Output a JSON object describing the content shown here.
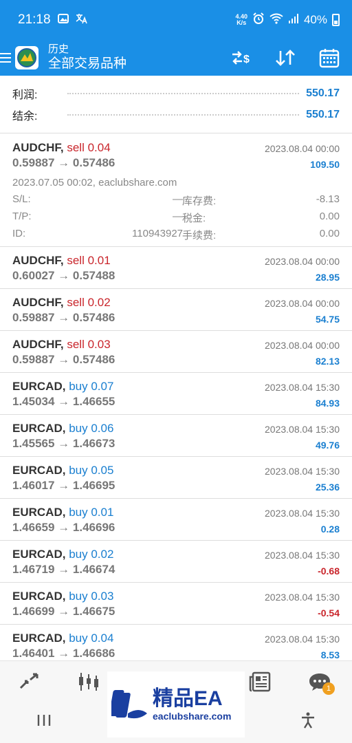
{
  "status_bar": {
    "time": "21:18",
    "net_speed_top": "4.40",
    "net_speed_bottom": "K/s",
    "battery": "40%"
  },
  "app_bar": {
    "title": "历史",
    "subtitle": "全部交易品种"
  },
  "summary": {
    "profit_label": "利润:",
    "profit_value": "550.17",
    "balance_label": "结余:",
    "balance_value": "550.17"
  },
  "trades": [
    {
      "symbol": "AUDCHF,",
      "side": "sell 0.04",
      "side_type": "sell",
      "open": "0.59887",
      "close": "0.57486",
      "date": "2023.08.04 00:00",
      "profit": "109.50",
      "details": {
        "open_time": "2023.07.05 00:02, eaclubshare.com",
        "sl_label": "S/L:",
        "sl_value": "—",
        "swap_label": "库存费:",
        "swap_value": "-8.13",
        "tp_label": "T/P:",
        "tp_value": "—",
        "tax_label": "税金:",
        "tax_value": "0.00",
        "id_label": "ID:",
        "id_value": "110943927",
        "fee_label": "手续费:",
        "fee_value": "0.00"
      }
    },
    {
      "symbol": "AUDCHF,",
      "side": "sell 0.01",
      "side_type": "sell",
      "open": "0.60027",
      "close": "0.57488",
      "date": "2023.08.04 00:00",
      "profit": "28.95"
    },
    {
      "symbol": "AUDCHF,",
      "side": "sell 0.02",
      "side_type": "sell",
      "open": "0.59887",
      "close": "0.57486",
      "date": "2023.08.04 00:00",
      "profit": "54.75"
    },
    {
      "symbol": "AUDCHF,",
      "side": "sell 0.03",
      "side_type": "sell",
      "open": "0.59887",
      "close": "0.57486",
      "date": "2023.08.04 00:00",
      "profit": "82.13"
    },
    {
      "symbol": "EURCAD,",
      "side": "buy 0.07",
      "side_type": "buy",
      "open": "1.45034",
      "close": "1.46655",
      "date": "2023.08.04 15:30",
      "profit": "84.93"
    },
    {
      "symbol": "EURCAD,",
      "side": "buy 0.06",
      "side_type": "buy",
      "open": "1.45565",
      "close": "1.46673",
      "date": "2023.08.04 15:30",
      "profit": "49.76"
    },
    {
      "symbol": "EURCAD,",
      "side": "buy 0.05",
      "side_type": "buy",
      "open": "1.46017",
      "close": "1.46695",
      "date": "2023.08.04 15:30",
      "profit": "25.36"
    },
    {
      "symbol": "EURCAD,",
      "side": "buy 0.01",
      "side_type": "buy",
      "open": "1.46659",
      "close": "1.46696",
      "date": "2023.08.04 15:30",
      "profit": "0.28"
    },
    {
      "symbol": "EURCAD,",
      "side": "buy 0.02",
      "side_type": "buy",
      "open": "1.46719",
      "close": "1.46674",
      "date": "2023.08.04 15:30",
      "profit": "-0.68"
    },
    {
      "symbol": "EURCAD,",
      "side": "buy 0.03",
      "side_type": "buy",
      "open": "1.46699",
      "close": "1.46675",
      "date": "2023.08.04 15:30",
      "profit": "-0.54"
    },
    {
      "symbol": "EURCAD,",
      "side": "buy 0.04",
      "side_type": "buy",
      "open": "1.46401",
      "close": "1.46686",
      "date": "2023.08.04 15:30",
      "profit": "8.53"
    }
  ],
  "bottom_nav": {
    "chat_badge": "1"
  },
  "watermark": {
    "title": "精品EA",
    "url": "eaclubshare.com"
  },
  "colors": {
    "header": "#1a8fe6",
    "sell": "#c9252b",
    "buy": "#1a7fd0",
    "profit_positive": "#1a7fd0",
    "profit_negative": "#c9252b"
  },
  "icons": [
    "menu-icon",
    "app-logo-icon",
    "currency-swap-icon",
    "sort-icon",
    "calendar-icon",
    "trade-icon",
    "chart-icon",
    "news-icon",
    "chat-icon"
  ]
}
